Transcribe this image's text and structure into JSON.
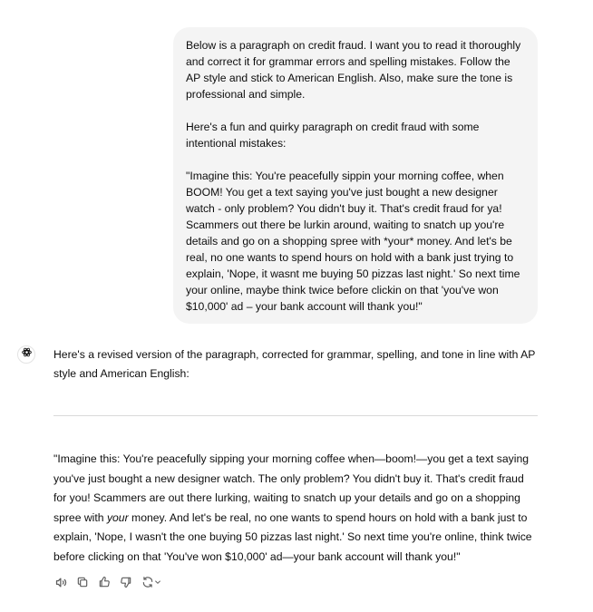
{
  "user_message": {
    "paragraphs": [
      "Below is a paragraph on credit fraud. I want you to read it thoroughly and correct it for grammar errors and spelling mistakes. Follow the AP style and stick to American English. Also, make sure the tone is professional and simple.",
      "Here's a fun and quirky paragraph on credit fraud with some intentional mistakes:",
      "\"Imagine this: You're peacefully sippin your morning coffee, when BOOM! You get a text saying you've just bought a new designer watch - only problem? You didn't buy it. That's credit fraud for ya! Scammers out there be lurkin around, waiting to snatch up you're details and go on a shopping spree with *your* money. And let's be real, no one wants to spend hours on hold with a bank just trying to explain, 'Nope, it wasnt me buying 50 pizzas last night.' So next time your online, maybe think twice before clickin on that 'you've won $10,000' ad – your bank account will thank you!\""
    ]
  },
  "assistant_message": {
    "avatar_icon": "openai-logo-icon",
    "intro": "Here's a revised version of the paragraph, corrected for grammar, spelling, and tone in line with AP style and American English:",
    "revised_part1": "\"Imagine this: You're peacefully sipping your morning coffee when—boom!—you get a text saying you've just bought a new designer watch. The only problem? You didn't buy it. That's credit fraud for you! Scammers are out there lurking, waiting to snatch up your details and go on a shopping spree with ",
    "revised_emphasis": "your",
    "revised_part2": " money. And let's be real, no one wants to spend hours on hold with a bank just to explain, 'Nope, I wasn't the one buying 50 pizzas last night.' So next time you're online, think twice before clicking on that 'You've won $10,000' ad—your bank account will thank you!\""
  },
  "actions": {
    "icons": [
      "speaker-icon",
      "copy-icon",
      "thumbs-up-icon",
      "thumbs-down-icon",
      "regenerate-icon"
    ]
  },
  "colors": {
    "bubble_bg": "#f4f4f4",
    "text": "#0d0d0d",
    "icon": "#5d5d5d",
    "divider": "#d9d9d9"
  }
}
